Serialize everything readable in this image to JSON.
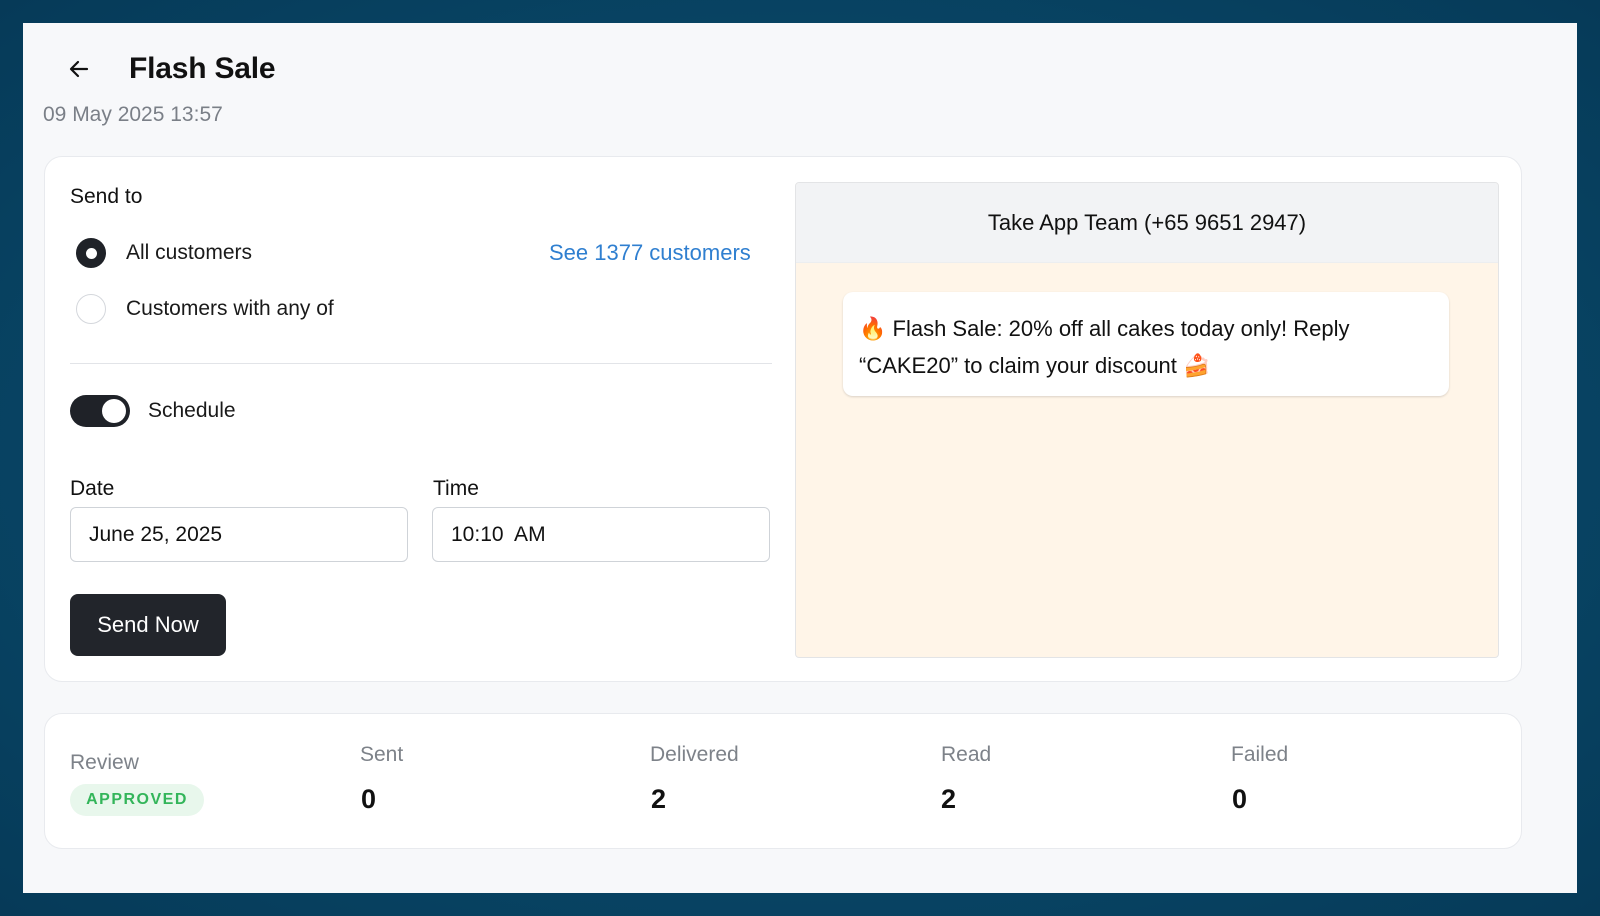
{
  "header": {
    "back_icon": "arrow-left-icon",
    "title": "Flash Sale",
    "timestamp": "09 May 2025 13:57"
  },
  "audience": {
    "label": "Send to",
    "options": [
      {
        "label": "All customers",
        "checked": true
      },
      {
        "label": "Customers with any of",
        "checked": false
      }
    ],
    "see_link": "See 1377 customers"
  },
  "schedule": {
    "label": "Schedule",
    "enabled": true,
    "date_label": "Date",
    "date_value": "June 25, 2025",
    "time_label": "Time",
    "time_value": "10:10  AM",
    "send_label": "Send Now"
  },
  "preview": {
    "sender": "Take App Team (+65 9651 2947)",
    "message": "🔥 Flash Sale: 20% off all cakes today only! Reply “CAKE20” to claim your discount 🍰"
  },
  "stats": {
    "review_label": "Review",
    "review_status": "APPROVED",
    "sent_label": "Sent",
    "sent_value": "0",
    "delivered_label": "Delivered",
    "delivered_value": "2",
    "read_label": "Read",
    "read_value": "2",
    "failed_label": "Failed",
    "failed_value": "0"
  },
  "colors": {
    "accent_link": "#2f7fd0",
    "primary_dark": "#22252b",
    "approved_text": "#33b55a",
    "approved_bg": "#e8f7ec",
    "preview_bg": "#fff5e8"
  }
}
